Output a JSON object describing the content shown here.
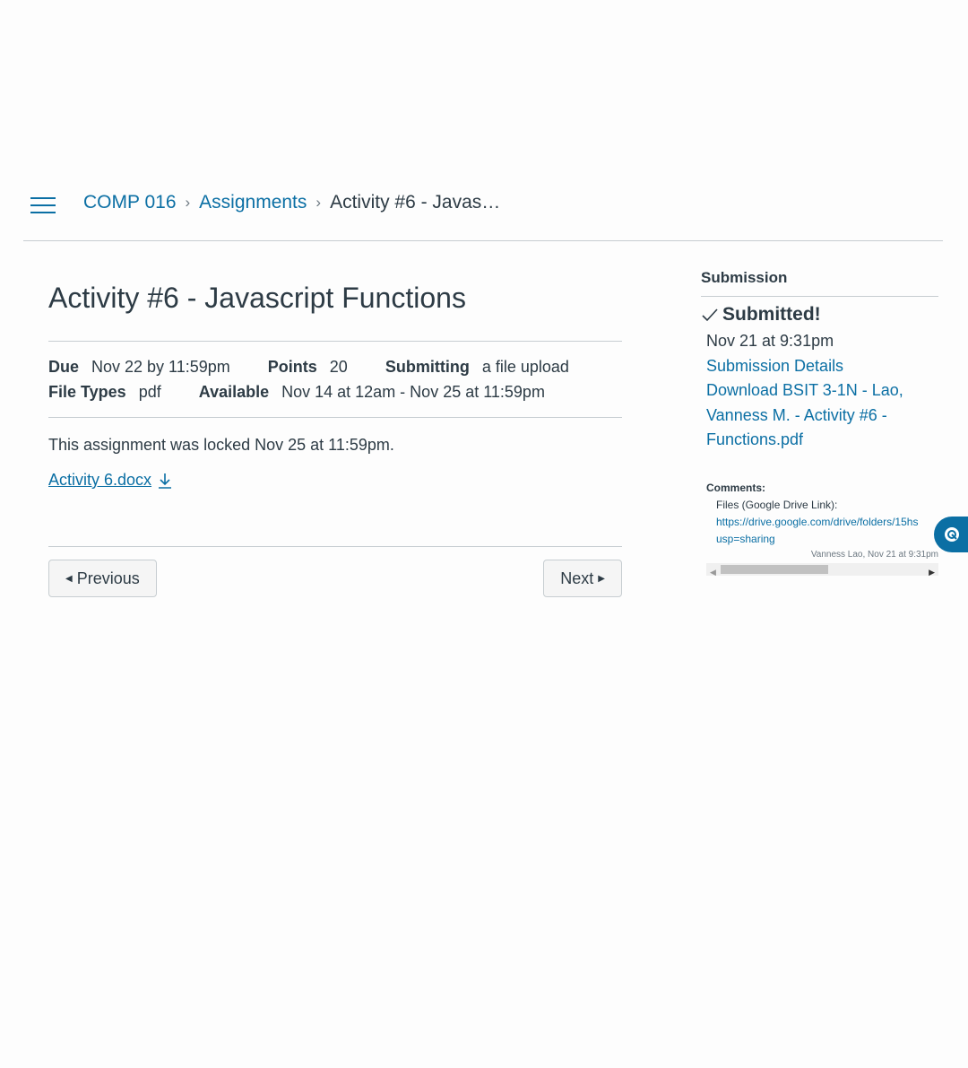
{
  "breadcrumb": {
    "course": "COMP 016",
    "section": "Assignments",
    "current": "Activity #6 - Javas…"
  },
  "assignment": {
    "title": "Activity #6 - Javascript Functions",
    "due_label": "Due",
    "due_value": "Nov 22 by 11:59pm",
    "points_label": "Points",
    "points_value": "20",
    "submitting_label": "Submitting",
    "submitting_value": "a file upload",
    "filetypes_label": "File Types",
    "filetypes_value": "pdf",
    "available_label": "Available",
    "available_value": "Nov 14 at 12am - Nov 25 at 11:59pm",
    "locked_notice": "This assignment was locked Nov 25 at 11:59pm.",
    "attachment": "Activity 6.docx"
  },
  "pager": {
    "previous": "Previous",
    "next": "Next"
  },
  "submission": {
    "heading": "Submission",
    "status": "Submitted!",
    "submitted_at": "Nov 21 at 9:31pm",
    "details_link": "Submission Details",
    "download_link": "Download BSIT 3-1N - Lao, Vanness M. - Activity #6 - Functions.pdf",
    "comments_label": "Comments:",
    "comment_line1": "Files (Google Drive Link):",
    "comment_line2": "https://drive.google.com/drive/folders/15hs",
    "comment_line3": "usp=sharing",
    "comment_author": "Vanness Lao, Nov 21 at 9:31pm"
  },
  "icons": {
    "menu": "hamburger-icon",
    "separator": "chevron-right-icon",
    "download": "download-icon",
    "check": "check-icon",
    "floating": "chat-icon"
  },
  "colors": {
    "link": "#0b6fa4",
    "text": "#2d3b45",
    "border": "#c7cdd1"
  }
}
